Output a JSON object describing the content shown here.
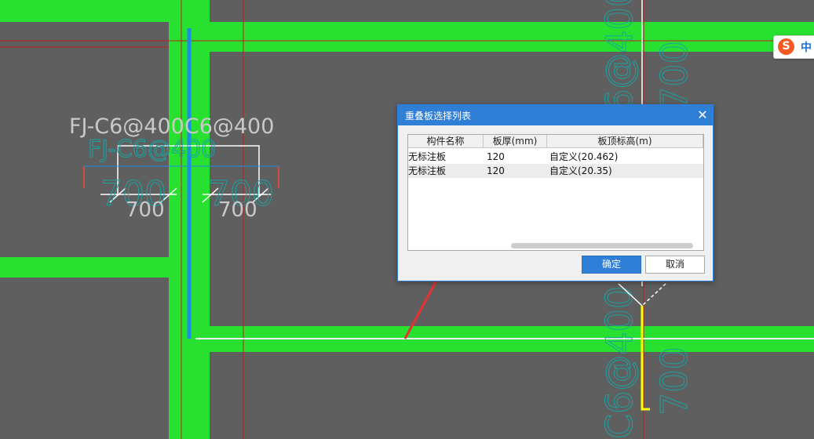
{
  "canvas": {
    "colors": {
      "background": "#5f5f5f",
      "beam": "#27e02f",
      "axis_line": "#c41e1e",
      "rebar_blue": "#1c8ce8",
      "rebar_yellow": "#ffff00",
      "annotation": "#1aa3a3",
      "arrow": "#e53333"
    },
    "rebar_label": "FJ-C6@400C6@400",
    "dim_labels": [
      "700",
      "700"
    ],
    "dim_overlay_labels": [
      "700",
      "700"
    ],
    "faded_label": "FJ-C6@400",
    "right_annotation_top": "C6@400",
    "right_annotation_bottom": "C6@400",
    "right_dim_labels": [
      "700",
      "700"
    ]
  },
  "ime": {
    "logo": "S",
    "mode": "中"
  },
  "dialog": {
    "title": "重叠板选择列表",
    "close_icon": "✕",
    "columns": [
      "构件名称",
      "板厚(mm)",
      "板顶标高(m)"
    ],
    "rows": [
      {
        "name": "无标注板",
        "thickness": "120",
        "elevation": "自定义(20.462)"
      },
      {
        "name": "无标注板",
        "thickness": "120",
        "elevation": "自定义(20.35)"
      }
    ],
    "ok_label": "确定",
    "cancel_label": "取消"
  }
}
